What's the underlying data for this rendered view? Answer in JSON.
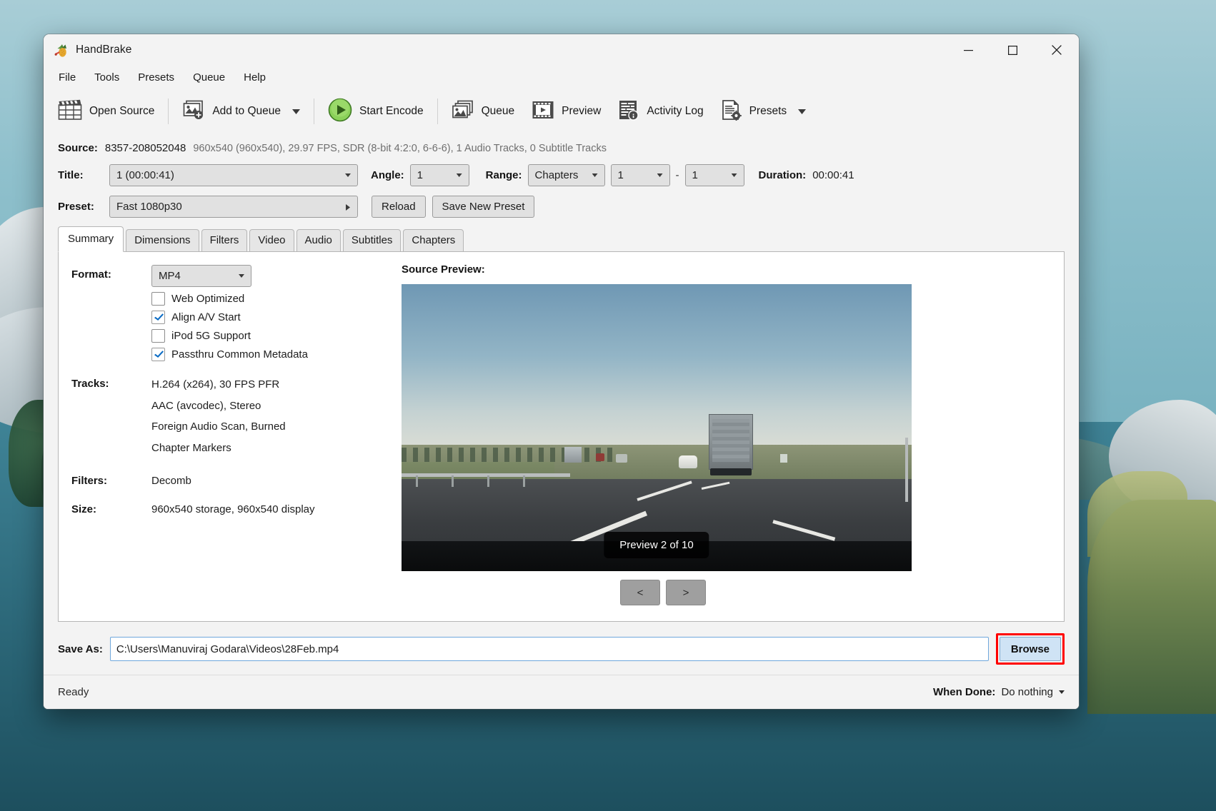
{
  "window": {
    "title": "HandBrake",
    "app_icon": "pineapple-icon",
    "controls": {
      "minimize": "minimize-icon",
      "maximize": "maximize-icon",
      "close": "close-icon"
    }
  },
  "menubar": {
    "items": [
      "File",
      "Tools",
      "Presets",
      "Queue",
      "Help"
    ]
  },
  "toolbar": {
    "items": [
      {
        "label": "Open Source",
        "icon": "film-clapper-icon",
        "caret": false
      },
      {
        "label": "Add to Queue",
        "icon": "add-image-icon",
        "caret": true
      },
      {
        "label": "Start Encode",
        "icon": "green-play-icon",
        "caret": false
      },
      {
        "label": "Queue",
        "icon": "images-stack-icon",
        "caret": false
      },
      {
        "label": "Preview",
        "icon": "film-play-icon",
        "caret": false
      },
      {
        "label": "Activity Log",
        "icon": "log-info-icon",
        "caret": false
      },
      {
        "label": "Presets",
        "icon": "document-gear-icon",
        "caret": true
      }
    ]
  },
  "source": {
    "label": "Source:",
    "name": "8357-208052048",
    "detail": "960x540 (960x540), 29.97 FPS, SDR (8-bit 4:2:0, 6-6-6), 1 Audio Tracks, 0 Subtitle Tracks"
  },
  "title_row": {
    "title_label": "Title:",
    "title_value": "1  (00:00:41)",
    "angle_label": "Angle:",
    "angle_value": "1",
    "range_label": "Range:",
    "range_value": "Chapters",
    "range_start": "1",
    "range_dash": "-",
    "range_end": "1",
    "duration_label": "Duration:",
    "duration_value": "00:00:41"
  },
  "preset_row": {
    "preset_label": "Preset:",
    "preset_value": "Fast 1080p30",
    "reload_label": "Reload",
    "save_new_preset_label": "Save New Preset"
  },
  "tabs": [
    {
      "label": "Summary",
      "active": true
    },
    {
      "label": "Dimensions",
      "active": false
    },
    {
      "label": "Filters",
      "active": false
    },
    {
      "label": "Video",
      "active": false
    },
    {
      "label": "Audio",
      "active": false
    },
    {
      "label": "Subtitles",
      "active": false
    },
    {
      "label": "Chapters",
      "active": false
    }
  ],
  "summary": {
    "format_label": "Format:",
    "format_value": "MP4",
    "checkboxes": [
      {
        "label": "Web Optimized",
        "checked": false
      },
      {
        "label": "Align A/V Start",
        "checked": true
      },
      {
        "label": "iPod 5G Support",
        "checked": false
      },
      {
        "label": "Passthru Common Metadata",
        "checked": true
      }
    ],
    "tracks_label": "Tracks:",
    "tracks_values": [
      "H.264 (x264), 30 FPS PFR",
      "AAC (avcodec), Stereo",
      "Foreign Audio Scan, Burned",
      "Chapter Markers"
    ],
    "filters_label": "Filters:",
    "filters_value": "Decomb",
    "size_label": "Size:",
    "size_value": "960x540 storage, 960x540 display"
  },
  "preview": {
    "title": "Source Preview:",
    "badge": "Preview 2 of 10",
    "prev_label": "<",
    "next_label": ">"
  },
  "save_as": {
    "label": "Save As:",
    "value": "C:\\Users\\Manuviraj Godara\\Videos\\28Feb.mp4",
    "placeholder": "",
    "browse_label": "Browse",
    "browse_highlight_color": "#ff0000"
  },
  "statusbar": {
    "status": "Ready",
    "when_done_label": "When Done:",
    "when_done_value": "Do nothing"
  },
  "colors": {
    "window_bg": "#f3f3f3",
    "panel_bg": "#ffffff",
    "accent_check": "#0c6cc4",
    "highlight": "#ff0000",
    "desktop": "#2d6878"
  }
}
